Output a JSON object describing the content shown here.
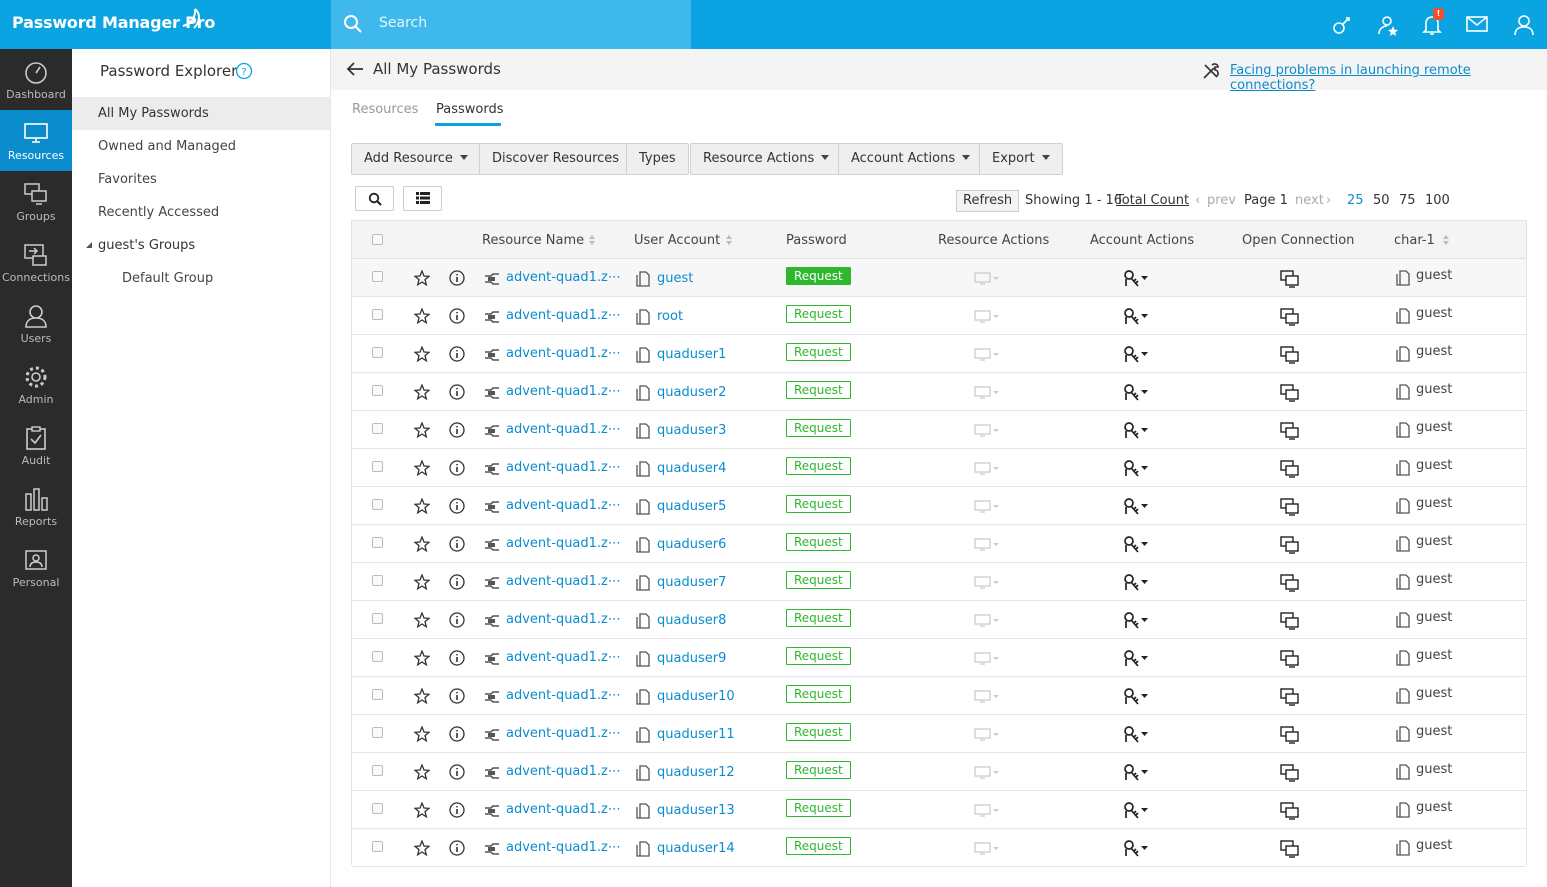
{
  "app": {
    "title": "Password Manager Pro"
  },
  "search": {
    "placeholder": "Search"
  },
  "topbar": {
    "notification_count": "!"
  },
  "rail": [
    {
      "label": "Dashboard",
      "icon": "dashboard-icon"
    },
    {
      "label": "Resources",
      "icon": "monitor-icon"
    },
    {
      "label": "Groups",
      "icon": "groups-icon"
    },
    {
      "label": "Connections",
      "icon": "connections-icon"
    },
    {
      "label": "Users",
      "icon": "user-icon"
    },
    {
      "label": "Admin",
      "icon": "gear-icon"
    },
    {
      "label": "Audit",
      "icon": "clipboard-icon"
    },
    {
      "label": "Reports",
      "icon": "bar-chart-icon"
    },
    {
      "label": "Personal",
      "icon": "personal-icon"
    }
  ],
  "explorer": {
    "title": "Password Explorer",
    "items": [
      "All My Passwords",
      "Owned and Managed",
      "Favorites",
      "Recently Accessed",
      "guest's Groups",
      "Default Group"
    ]
  },
  "header": {
    "title": "All My Passwords",
    "help_link": "Facing problems in launching remote connections?"
  },
  "tabs": [
    "Resources",
    "Passwords"
  ],
  "toolbar": [
    "Add Resource",
    "Discover Resources",
    "Types",
    "Resource Actions",
    "Account Actions",
    "Export"
  ],
  "pager": {
    "refresh": "Refresh",
    "showing": "Showing 1 - 16",
    "total": "Total Count",
    "prev": "prev",
    "page": "Page 1",
    "next": "next",
    "sizes": [
      "25",
      "50",
      "75",
      "100"
    ]
  },
  "table": {
    "columns": [
      "Resource Name",
      "User Account",
      "Password",
      "Resource Actions",
      "Account Actions",
      "Open Connection",
      "char-1"
    ],
    "rows": [
      {
        "resource": "advent-quad1.z⋯",
        "account": "guest",
        "password": "Request",
        "owner": "guest"
      },
      {
        "resource": "advent-quad1.z⋯",
        "account": "root",
        "password": "Request",
        "owner": "guest"
      },
      {
        "resource": "advent-quad1.z⋯",
        "account": "quaduser1",
        "password": "Request",
        "owner": "guest"
      },
      {
        "resource": "advent-quad1.z⋯",
        "account": "quaduser2",
        "password": "Request",
        "owner": "guest"
      },
      {
        "resource": "advent-quad1.z⋯",
        "account": "quaduser3",
        "password": "Request",
        "owner": "guest"
      },
      {
        "resource": "advent-quad1.z⋯",
        "account": "quaduser4",
        "password": "Request",
        "owner": "guest"
      },
      {
        "resource": "advent-quad1.z⋯",
        "account": "quaduser5",
        "password": "Request",
        "owner": "guest"
      },
      {
        "resource": "advent-quad1.z⋯",
        "account": "quaduser6",
        "password": "Request",
        "owner": "guest"
      },
      {
        "resource": "advent-quad1.z⋯",
        "account": "quaduser7",
        "password": "Request",
        "owner": "guest"
      },
      {
        "resource": "advent-quad1.z⋯",
        "account": "quaduser8",
        "password": "Request",
        "owner": "guest"
      },
      {
        "resource": "advent-quad1.z⋯",
        "account": "quaduser9",
        "password": "Request",
        "owner": "guest"
      },
      {
        "resource": "advent-quad1.z⋯",
        "account": "quaduser10",
        "password": "Request",
        "owner": "guest"
      },
      {
        "resource": "advent-quad1.z⋯",
        "account": "quaduser11",
        "password": "Request",
        "owner": "guest"
      },
      {
        "resource": "advent-quad1.z⋯",
        "account": "quaduser12",
        "password": "Request",
        "owner": "guest"
      },
      {
        "resource": "advent-quad1.z⋯",
        "account": "quaduser13",
        "password": "Request",
        "owner": "guest"
      },
      {
        "resource": "advent-quad1.z⋯",
        "account": "quaduser14",
        "password": "Request",
        "owner": "guest"
      }
    ]
  },
  "colors": {
    "topbar": "#0aa4e2",
    "rail": "#2b2b2b",
    "rail_active": "#0a8ccd",
    "link": "#0a8ccd",
    "request_green": "#2eb82e"
  }
}
